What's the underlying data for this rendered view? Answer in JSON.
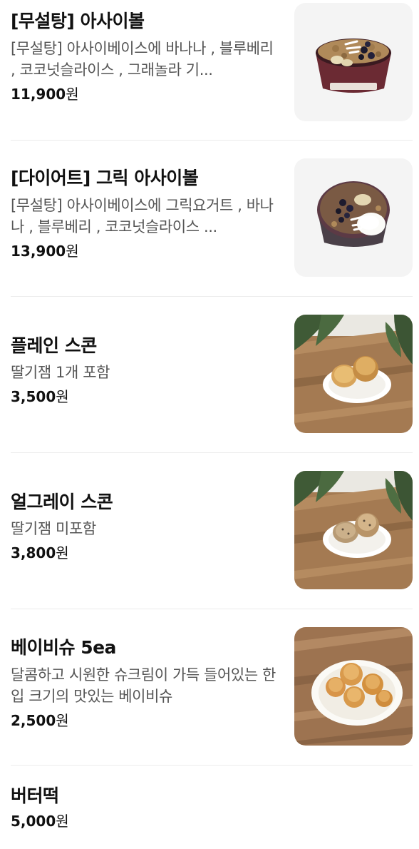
{
  "menu": {
    "items": [
      {
        "name": "[무설탕] 아사이볼",
        "description": "[무설탕] 아사이베이스에 바나나 , 블루베리 , 코코넛슬라이스 , 그래놀라 기...",
        "price_amount": "11,900",
        "price_unit": "원",
        "image_icon": "acai-bowl-image"
      },
      {
        "name": "[다이어트] 그릭 아사이볼",
        "description": "[무설탕] 아사이베이스에 그릭요거트 , 바나나 , 블루베리 , 코코넛슬라이스 ...",
        "price_amount": "13,900",
        "price_unit": "원",
        "image_icon": "greek-acai-bowl-image"
      },
      {
        "name": "플레인 스콘",
        "description": "딸기잼 1개 포함",
        "price_amount": "3,500",
        "price_unit": "원",
        "image_icon": "plain-scone-image"
      },
      {
        "name": "얼그레이 스콘",
        "description": "딸기잼 미포함",
        "price_amount": "3,800",
        "price_unit": "원",
        "image_icon": "earl-grey-scone-image"
      },
      {
        "name": "베이비슈 5ea",
        "description": "달콤하고 시원한 슈크림이 가득 들어있는 한입 크기의 맛있는 베이비슈",
        "price_amount": "2,500",
        "price_unit": "원",
        "image_icon": "baby-choux-image"
      },
      {
        "name": "버터떡",
        "price_amount": "5,000",
        "price_unit": "원"
      }
    ]
  },
  "colors": {
    "text_primary": "#111111",
    "text_secondary": "#555555",
    "divider": "#ececec",
    "thumb_background": "#f4f4f4"
  }
}
